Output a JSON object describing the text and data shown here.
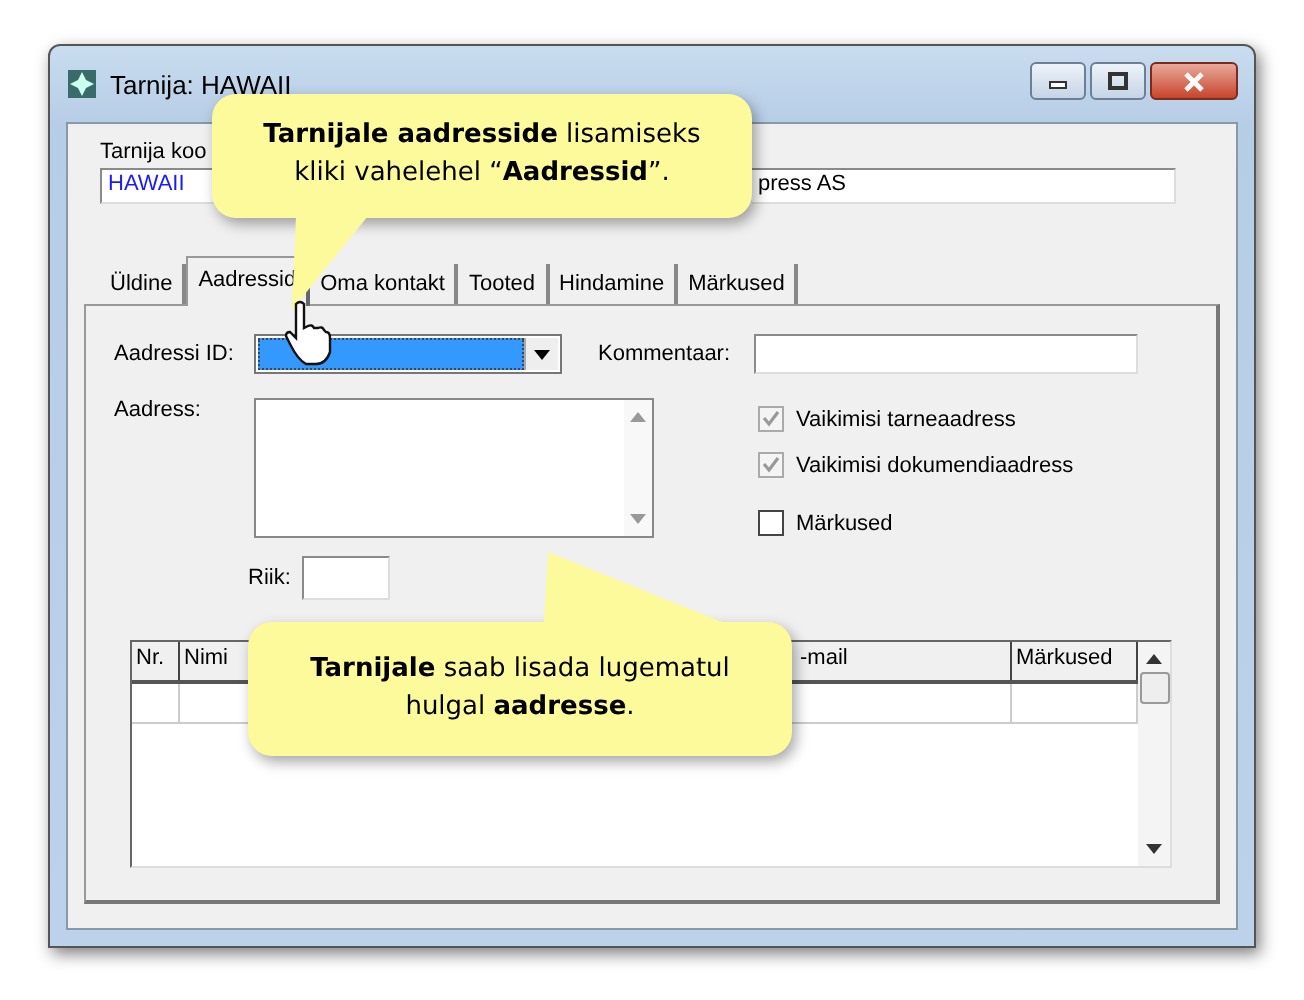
{
  "window": {
    "title": "Tarnija: HAWAII"
  },
  "header": {
    "code_label": "Tarnija koo",
    "code_value": "HAWAII",
    "name_value": "press AS"
  },
  "tabs": [
    {
      "label": "Üldine",
      "selected": false
    },
    {
      "label": "Aadressid",
      "selected": true
    },
    {
      "label": "Oma kontakt",
      "selected": false
    },
    {
      "label": "Tooted",
      "selected": false
    },
    {
      "label": "Hindamine",
      "selected": false
    },
    {
      "label": "Märkused",
      "selected": false
    }
  ],
  "form": {
    "address_id_label": "Aadressi ID:",
    "comment_label": "Kommentaar:",
    "address_label": "Aadress:",
    "country_label": "Riik:"
  },
  "checkboxes": [
    {
      "label": "Vaikimisi tarneaadress",
      "checked": true,
      "disabled": true
    },
    {
      "label": "Vaikimisi dokumendiaadress",
      "checked": true,
      "disabled": true
    },
    {
      "label": "Märkused",
      "checked": false,
      "disabled": false
    }
  ],
  "table": {
    "columns": [
      "Nr.",
      "Nimi",
      "-mail",
      "Märkused"
    ]
  },
  "callouts": [
    {
      "text": "**Tarnijale aadresside** lisamiseks kliki vahelehel “**Aadressid**”."
    },
    {
      "text": "**Tarnijale** saab lisada lugematul hulgal **aadresse**."
    }
  ]
}
